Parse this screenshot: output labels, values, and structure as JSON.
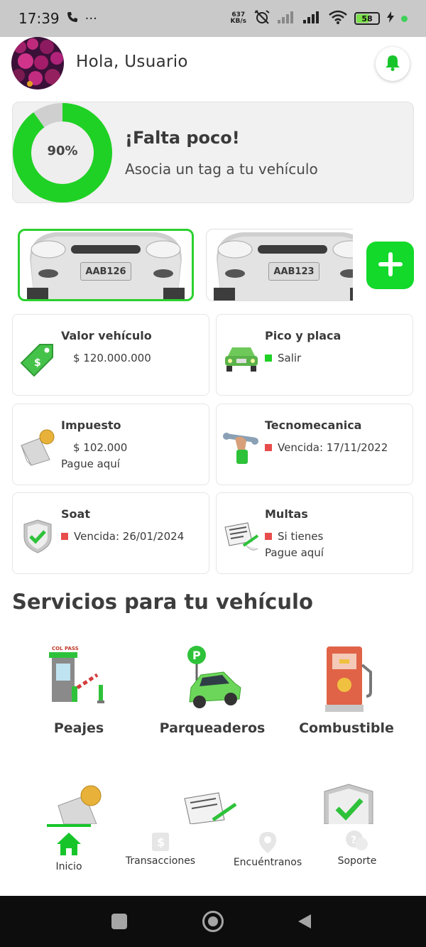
{
  "status_bar": {
    "time": "17:39",
    "network_speed_value": "637",
    "network_speed_unit": "KB/s",
    "battery_level": "58"
  },
  "header": {
    "greeting": "Hola, Usuario"
  },
  "progress": {
    "percent_label": "90%",
    "percent_value": 0.9,
    "title": "¡Falta poco!",
    "subtitle": "Asocia un tag a tu vehículo"
  },
  "vehicles": [
    {
      "plate": "AAB126"
    },
    {
      "plate": "AAB123"
    }
  ],
  "info_cards": {
    "valor": {
      "title": "Valor vehículo",
      "value": "$ 120.000.000"
    },
    "pico": {
      "title": "Pico y placa",
      "status": "Salir"
    },
    "impuesto": {
      "title": "Impuesto",
      "value": "$ 102.000",
      "action": "Pague aquí"
    },
    "tecno": {
      "title": "Tecnomecanica",
      "status": "Vencida: 17/11/2022"
    },
    "soat": {
      "title": "Soat",
      "status": "Vencida: 26/01/2024"
    },
    "multas": {
      "title": "Multas",
      "status": "Si tienes",
      "action": "Pague aquí"
    }
  },
  "services": {
    "title": "Servicios para tu vehículo",
    "items": [
      {
        "label": "Peajes",
        "brand": "COL PASS"
      },
      {
        "label": "Parqueaderos"
      },
      {
        "label": "Combustible"
      }
    ]
  },
  "bottom_nav": [
    {
      "label": "Inicio"
    },
    {
      "label": "Transacciones"
    },
    {
      "label": "Encuéntranos"
    },
    {
      "label": "Soporte"
    }
  ],
  "colors": {
    "accent_green": "#12d92a",
    "status_red": "#e84c4c",
    "status_green": "#1fd124"
  }
}
